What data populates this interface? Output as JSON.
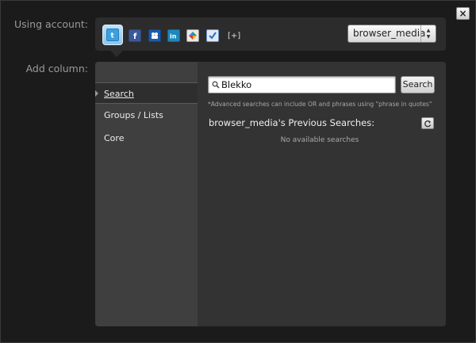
{
  "dialog": {
    "close_label": "×"
  },
  "account": {
    "label": "Using account:",
    "more_label": "[+]",
    "selected": "browser_media",
    "icons": [
      {
        "name": "twitter-icon",
        "glyph": "t",
        "color": "#3aa0e0",
        "selected": true
      },
      {
        "name": "facebook-icon",
        "glyph": "f",
        "color": "#3b5998"
      },
      {
        "name": "myspace-icon",
        "glyph": "m",
        "color": "#1b5ca8"
      },
      {
        "name": "linkedin-icon",
        "glyph": "in",
        "color": "#1d87bd"
      },
      {
        "name": "google-buzz-icon",
        "glyph": "b",
        "color": "#e0e0e0"
      },
      {
        "name": "foursquare-icon",
        "glyph": "✓",
        "color": "#3d8fd6"
      }
    ]
  },
  "add_column": {
    "label": "Add column:",
    "menu": [
      {
        "label": "Search",
        "active": true
      },
      {
        "label": "Groups / Lists",
        "active": false
      },
      {
        "label": "Core",
        "active": false
      }
    ]
  },
  "search": {
    "query": "Blekko",
    "button_label": "Search",
    "hint": "*Advanced searches can include OR and phrases using \"phrase in quotes\"",
    "previous_title": "browser_media's Previous Searches:",
    "empty_text": "No available searches"
  }
}
